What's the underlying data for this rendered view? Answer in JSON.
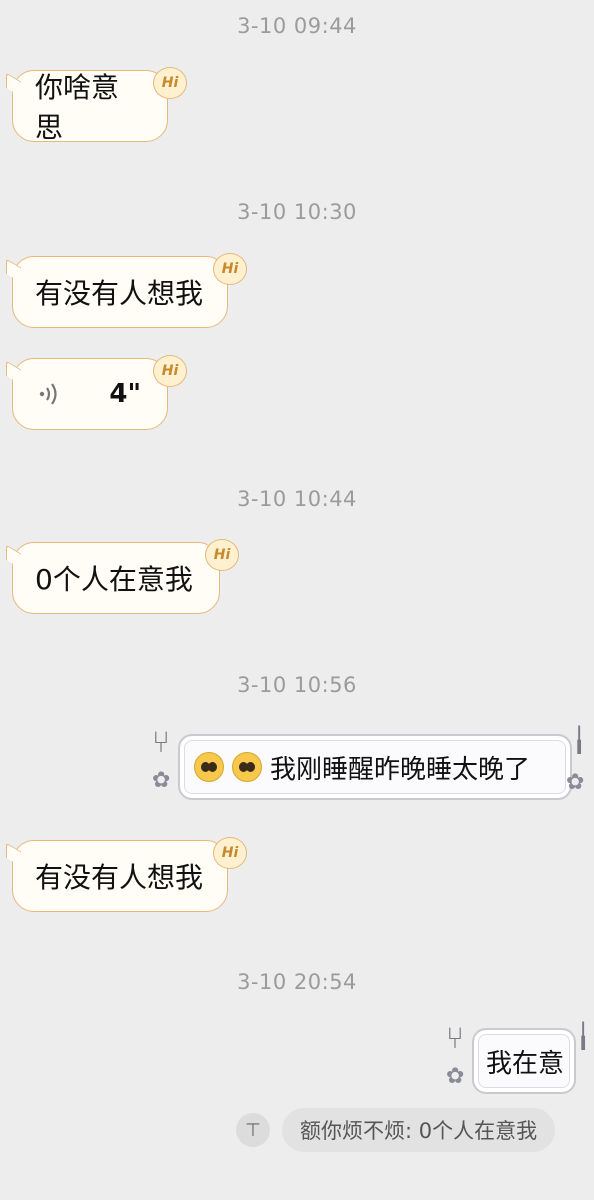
{
  "messages": {
    "ts1": "3-10 09:44",
    "m1": "你啥意思",
    "ts2": "3-10 10:30",
    "m2": "有没有人想我",
    "m3_duration": "4\"",
    "ts3": "3-10 10:44",
    "m4": "0个人在意我",
    "ts4": "3-10 10:56",
    "m5": "我刚睡醒昨晚睡太晚了",
    "m6": "有没有人想我",
    "ts5": "3-10 20:54",
    "m7": "我在意",
    "quote": "额你烦不烦: 0个人在意我"
  },
  "badge": {
    "hi": "Hi"
  },
  "icons": {
    "voice": "voice-wave-icon",
    "emoji": "pleading-face-icon",
    "quote": "quote-arrow-icon",
    "fork": "fork-icon",
    "bow": "ribbon-bow-icon"
  },
  "colors": {
    "background": "#ededed",
    "bubble_border": "#e6b97a",
    "bubble_fill": "#fffdf6",
    "timestamp": "#9b9b9b"
  }
}
